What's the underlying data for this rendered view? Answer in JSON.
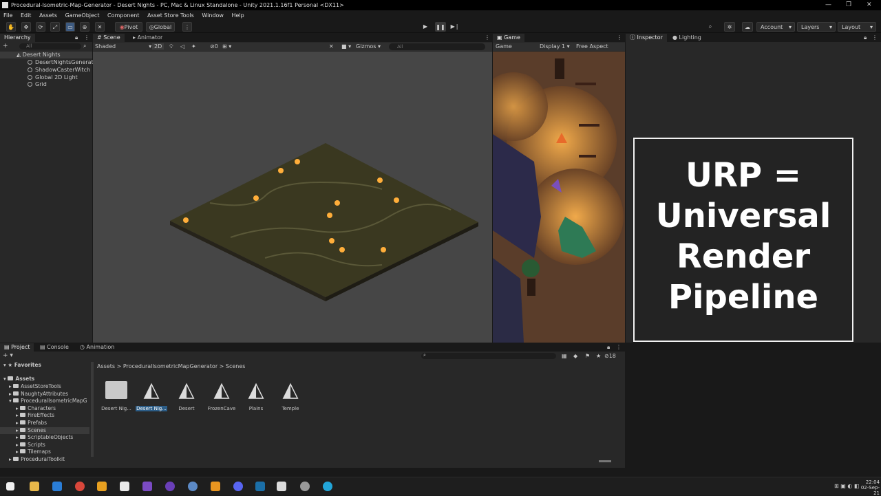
{
  "window": {
    "title": "Procedural-Isometric-Map-Generator - Desert Nights - PC, Mac & Linux Standalone - Unity 2021.1.16f1 Personal <DX11>",
    "controls": [
      "—",
      "❐",
      "✕"
    ]
  },
  "menu": [
    "File",
    "Edit",
    "Assets",
    "GameObject",
    "Component",
    "Asset Store Tools",
    "Window",
    "Help"
  ],
  "toolbar": {
    "pivot_label": "Pivot",
    "global_label": "Global",
    "account_label": "Account",
    "layers_label": "Layers",
    "layout_label": "Layout"
  },
  "hierarchy": {
    "tab": "Hierarchy",
    "search_placeholder": "All",
    "scene": "Desert Nights",
    "items": [
      "DesertNightsGenerator",
      "ShadowCasterWitch",
      "Global 2D Light",
      "Grid"
    ]
  },
  "scene_view": {
    "tabs": [
      "Scene",
      "Animator"
    ],
    "shading": "Shaded",
    "mode_2d": "2D",
    "gizmos": "Gizmos",
    "search_placeholder": "All",
    "count": "0"
  },
  "game_view": {
    "tab": "Game",
    "mode": "Game",
    "display": "Display 1",
    "aspect": "Free Aspect"
  },
  "inspector": {
    "tabs": [
      "Inspector",
      "Lighting"
    ]
  },
  "overlay": {
    "lines": [
      "URP =",
      "Universal",
      "Render",
      "Pipeline"
    ]
  },
  "project": {
    "tabs": [
      "Project",
      "Console",
      "Animation"
    ],
    "favorites": "Favorites",
    "root": "Assets",
    "tree": [
      {
        "label": "AssetStoreTools",
        "depth": 1
      },
      {
        "label": "NaughtyAttributes",
        "depth": 1
      },
      {
        "label": "ProceduralIsometricMapG",
        "depth": 1
      },
      {
        "label": "Characters",
        "depth": 2
      },
      {
        "label": "FireEffects",
        "depth": 2
      },
      {
        "label": "Prefabs",
        "depth": 2
      },
      {
        "label": "Scenes",
        "depth": 2
      },
      {
        "label": "ScriptableObjects",
        "depth": 2
      },
      {
        "label": "Scripts",
        "depth": 2
      },
      {
        "label": "Tilemaps",
        "depth": 2
      },
      {
        "label": "ProceduralToolkit",
        "depth": 1
      }
    ],
    "breadcrumb": [
      "Assets",
      "ProceduralIsometricMapGenerator",
      "Scenes"
    ],
    "hidden_count": "18",
    "assets": [
      {
        "label": "Desert Nig...",
        "kind": "folder"
      },
      {
        "label": "Desert Nig...",
        "kind": "unity",
        "selected": true
      },
      {
        "label": "Desert",
        "kind": "unity"
      },
      {
        "label": "FrozenCave",
        "kind": "unity"
      },
      {
        "label": "Plains",
        "kind": "unity"
      },
      {
        "label": "Temple",
        "kind": "unity"
      }
    ]
  },
  "taskbar": {
    "time": "22:04",
    "date": "02-Sep-21"
  },
  "colors": {
    "accent": "#2c5d87",
    "panel": "#282828",
    "chrome": "#191919"
  }
}
